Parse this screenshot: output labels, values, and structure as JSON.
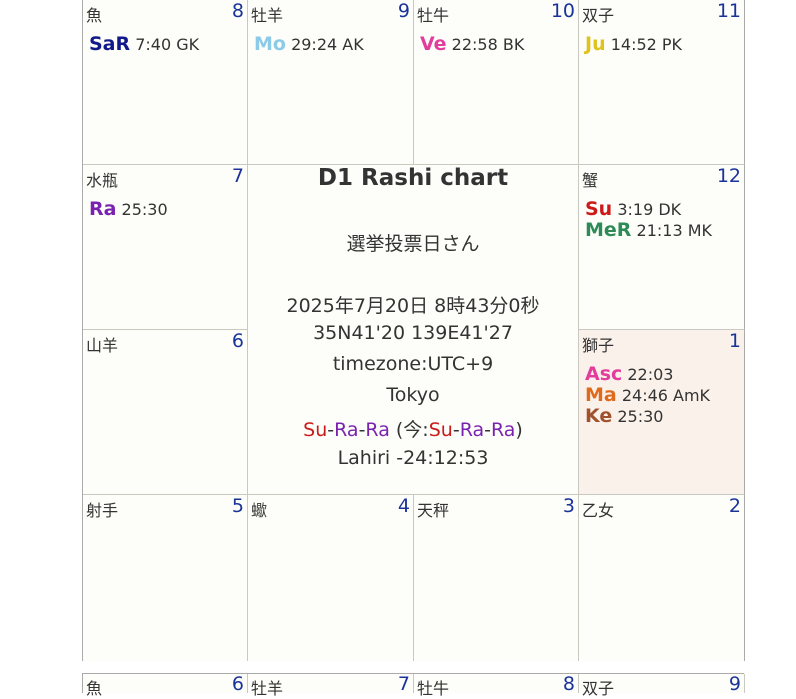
{
  "houses": [
    {
      "sign": "魚",
      "num": "8",
      "planets": [
        {
          "name": "SaR",
          "info": "7:40 GK",
          "color": "#101a8a"
        }
      ]
    },
    {
      "sign": "牡羊",
      "num": "9",
      "planets": [
        {
          "name": "Mo",
          "info": "29:24 AK",
          "color": "#8ccbe8"
        }
      ]
    },
    {
      "sign": "牡牛",
      "num": "10",
      "planets": [
        {
          "name": "Ve",
          "info": "22:58 BK",
          "color": "#e23d9c"
        }
      ]
    },
    {
      "sign": "双子",
      "num": "11",
      "planets": [
        {
          "name": "Ju",
          "info": "14:52 PK",
          "color": "#e0c21c"
        }
      ]
    },
    {
      "sign": "水瓶",
      "num": "7",
      "planets": [
        {
          "name": "Ra",
          "info": "25:30",
          "color": "#7a22b0"
        }
      ]
    },
    {
      "sign": "蟹",
      "num": "12",
      "planets": [
        {
          "name": "Su",
          "info": "3:19 DK",
          "color": "#cc1a1a"
        },
        {
          "name": "MeR",
          "info": "21:13 MK",
          "color": "#2e8b57"
        }
      ]
    },
    {
      "sign": "山羊",
      "num": "6",
      "planets": []
    },
    {
      "sign": "獅子",
      "num": "1",
      "planets": [
        {
          "name": "Asc",
          "info": "22:03",
          "color": "#e23d9c"
        },
        {
          "name": "Ma",
          "info": "24:46 AmK",
          "color": "#e06a1c"
        },
        {
          "name": "Ke",
          "info": "25:30",
          "color": "#a0522d"
        }
      ]
    },
    {
      "sign": "射手",
      "num": "5",
      "planets": []
    },
    {
      "sign": "蠍",
      "num": "4",
      "planets": []
    },
    {
      "sign": "天秤",
      "num": "3",
      "planets": []
    },
    {
      "sign": "乙女",
      "num": "2",
      "planets": []
    }
  ],
  "center": {
    "title": "D1 Rashi chart",
    "name": "選挙投票日さん",
    "datetime": "2025年7月20日 8時43分0秒",
    "coords": "35N41'20 139E41'27",
    "timezone": "timezone:UTC+9",
    "place": "Tokyo",
    "dasha": {
      "su": "Su",
      "dash": "-",
      "ra": "Ra",
      "now_open": " (今:",
      "now_close": ")"
    },
    "ayanamsa": "Lahiri -24:12:53"
  },
  "next_chart": [
    {
      "sign": "魚",
      "num": "6"
    },
    {
      "sign": "牡羊",
      "num": "7"
    },
    {
      "sign": "牡牛",
      "num": "8"
    },
    {
      "sign": "双子",
      "num": "9"
    }
  ],
  "colors": {
    "house_number": "#1a3399",
    "highlight": "#faf1ea",
    "border": "#c9c9c0"
  }
}
